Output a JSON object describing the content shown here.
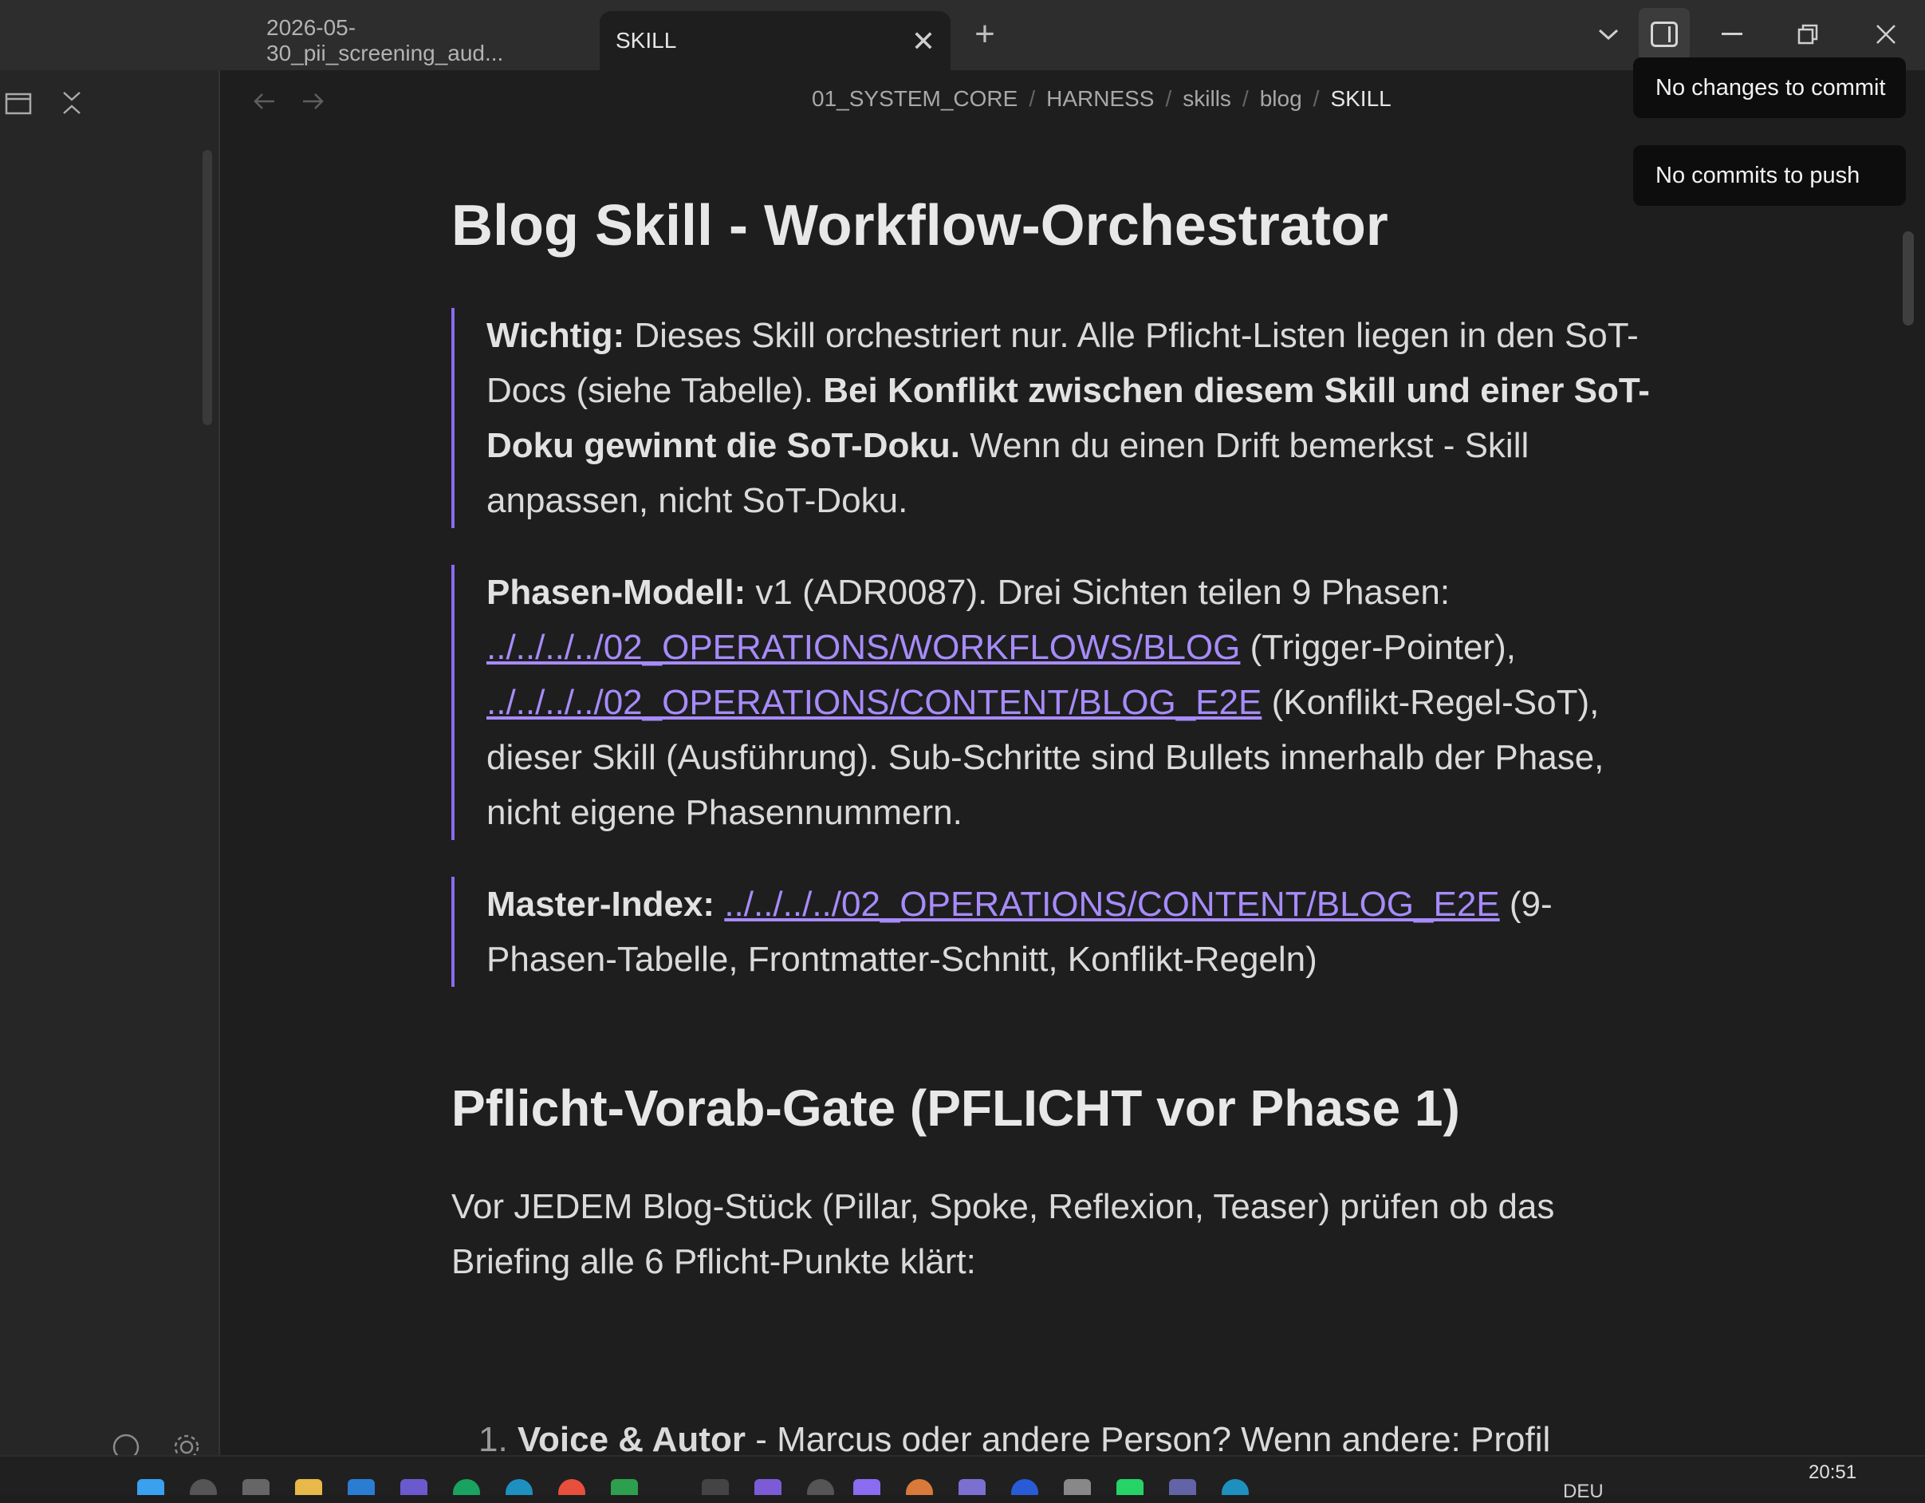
{
  "tabs": [
    {
      "label": "2026-05-30_pii_screening_aud..."
    },
    {
      "label": "SKILL",
      "close": "✕"
    }
  ],
  "new_tab_icon": "+",
  "breadcrumb": [
    "01_SYSTEM_CORE",
    "HARNESS",
    "skills",
    "blog",
    "SKILL"
  ],
  "breadcrumb_sep": "/",
  "toasts": [
    "No changes to commit",
    "No commits to push"
  ],
  "doc": {
    "title": "Blog Skill - Workflow-Orchestrator",
    "callout1": {
      "label": "Wichtig:",
      "text1": " Dieses Skill orchestriert nur. Alle Pflicht-Listen liegen in den SoT-Docs (siehe Tabelle). ",
      "bold": "Bei Konflikt zwischen diesem Skill und einer SoT-Doku gewinnt die SoT-Doku.",
      "text2": " Wenn du einen Drift bemerkst - Skill anpassen, nicht SoT-Doku."
    },
    "callout2": {
      "label": "Phasen-Modell:",
      "text1": " v1 (ADR0087). Drei Sichten teilen 9 Phasen: ",
      "link1": "../../../../02_OPERATIONS/WORKFLOWS/BLOG",
      "text2": " (Trigger-Pointer), ",
      "link2": "../../../../02_OPERATIONS/CONTENT/BLOG_E2E",
      "text3": " (Konflikt-Regel-SoT), dieser Skill (Ausführung). Sub-Schritte sind Bullets innerhalb der Phase, nicht eigene Phasennummern."
    },
    "callout3": {
      "label": "Master-Index:",
      "link": "../../../../02_OPERATIONS/CONTENT/BLOG_E2E",
      "text": " (9-Phasen-Tabelle, Frontmatter-Schnitt, Konflikt-Regeln)"
    },
    "h2": "Pflicht-Vorab-Gate (PFLICHT vor Phase 1)",
    "para": "Vor JEDEM Blog-Stück (Pillar, Spoke, Reflexion, Teaser) prüfen ob das Briefing alle 6 Pflicht-Punkte klärt:",
    "list_peek": {
      "num": "1.",
      "bold": "Voice & Autor",
      "text": " - Marcus oder andere Person? Wenn andere: Profil"
    }
  },
  "taskbar": {
    "clock": "20:51",
    "lang": "DEU"
  },
  "colors": {
    "accent": "#8a6cf0",
    "link": "#a78bfa",
    "bg": "#1e1e1e"
  }
}
